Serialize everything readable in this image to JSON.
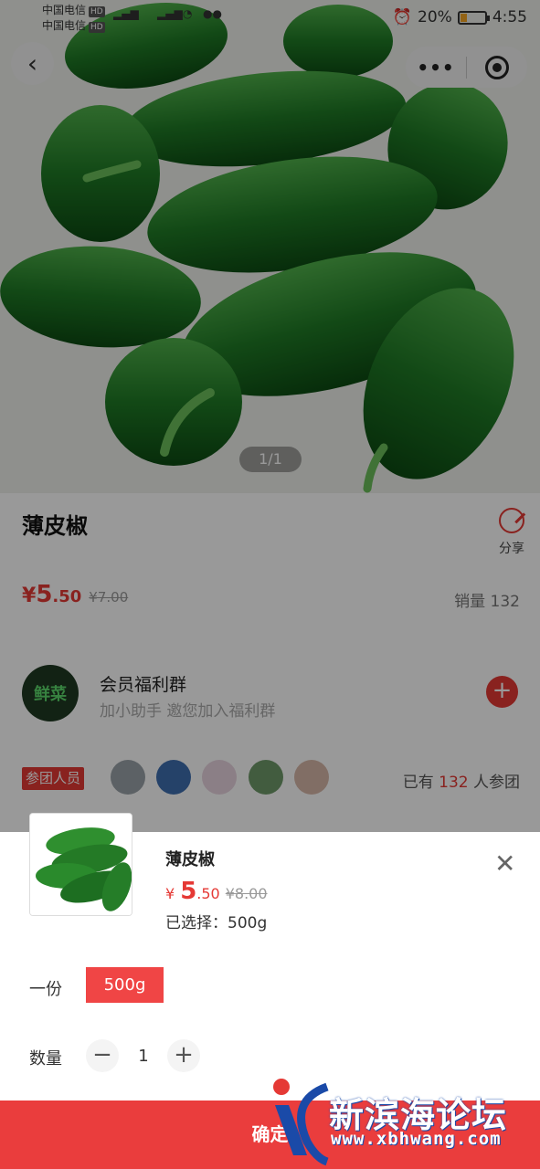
{
  "status_bar": {
    "carrier_1": "中国电信",
    "carrier_2": "中国电信",
    "hd": "HD",
    "network": "4G",
    "battery_percent": "20%",
    "time": "4:55"
  },
  "nav": {
    "back_icon": "chevron-left-icon",
    "more_label": "•••",
    "close_icon": "target-icon"
  },
  "gallery": {
    "pager": "1/1"
  },
  "product": {
    "title": "薄皮椒",
    "share_label": "分享",
    "price_symbol": "¥",
    "price_int": "5",
    "price_dec": ".50",
    "orig_price": "¥7.00",
    "sales": "销量 132"
  },
  "group": {
    "avatar_text": "鲜菜",
    "name": "会员福利群",
    "subtitle": "加小助手 邀您加入福利群",
    "add_label": "+"
  },
  "members": {
    "tag": "参团人员",
    "joined_prefix": "已有",
    "joined_count": "132",
    "joined_suffix": "人参团"
  },
  "sheet": {
    "title": "薄皮椒",
    "close_label": "✕",
    "price_symbol": "¥",
    "price_int": "5",
    "price_dec": ".50",
    "orig_price": "¥8.00",
    "selected": "已选择：500g",
    "spec_label": "一份",
    "spec_option": "500g",
    "qty_label": "数量",
    "qty_minus": "−",
    "qty_value": "1",
    "qty_plus": "+",
    "confirm_label": "确定"
  },
  "watermark": {
    "text": "新滨海论坛",
    "url": "www.xbhwang.com"
  },
  "colors": {
    "accent": "#e53935",
    "confirm_bg": "#ea3d3d",
    "overlay": "rgba(0,0,0,0.40)"
  }
}
